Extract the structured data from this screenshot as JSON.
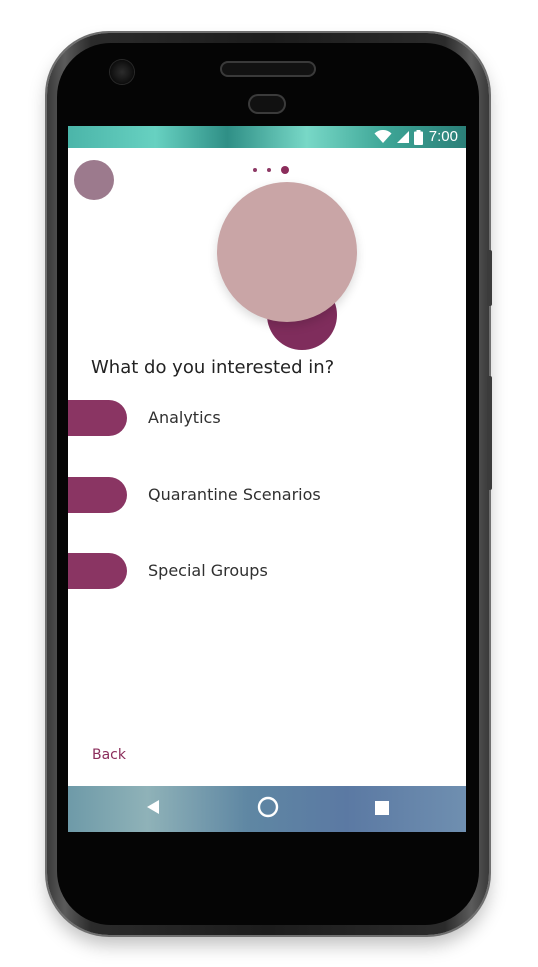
{
  "status_bar": {
    "time": "7:00",
    "icons": [
      "wifi-icon",
      "signal-icon",
      "battery-icon"
    ]
  },
  "pager": {
    "total": 3,
    "active_index": 2
  },
  "question": "What do you interested in?",
  "options": [
    {
      "label": "Analytics"
    },
    {
      "label": "Quarantine Scenarios"
    },
    {
      "label": "Special Groups"
    }
  ],
  "back_label": "Back",
  "nav_bar": {
    "icons": [
      "back-triangle-icon",
      "home-circle-icon",
      "recents-square-icon"
    ]
  },
  "colors": {
    "accent": "#8a3563",
    "avatar": "#9c7a8d",
    "deco_big": "#c9a5a6",
    "deco_small": "#7f2d5c"
  }
}
